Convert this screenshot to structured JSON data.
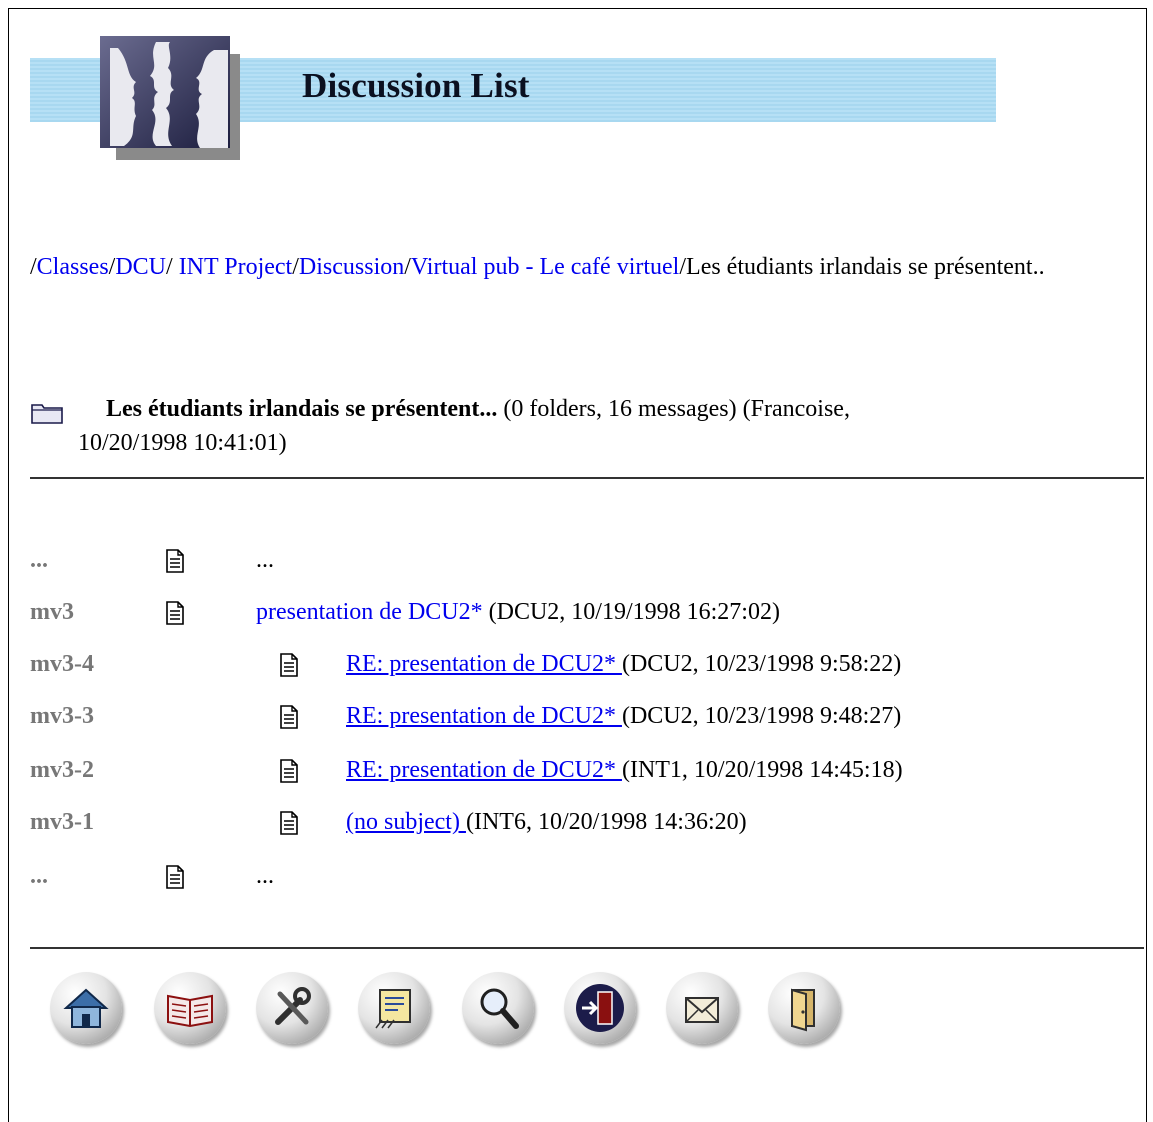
{
  "banner": {
    "title": "Discussion List"
  },
  "breadcrumb": {
    "sep": "/",
    "links": [
      "Classes",
      "DCU",
      " INT Project",
      "Discussion",
      "Virtual pub - Le café virtuel"
    ],
    "current": "Les étudiants irlandais se présentent.."
  },
  "folder": {
    "title": "Les étudiants irlandais se présentent...",
    "counts": "(0 folders, 16 messages)",
    "meta_line1": "(Francoise,",
    "meta_line2": "10/20/1998 10:41:01)"
  },
  "messages": [
    {
      "id": "...",
      "subject": "...",
      "meta": ""
    },
    {
      "id": "mv3",
      "subject": "presentation de DCU2*",
      "meta": " (DCU2, 10/19/1998 16:27:02)"
    },
    {
      "id": "mv3-4",
      "subject": "RE: presentation de DCU2* ",
      "meta": "(DCU2, 10/23/1998 9:58:22)"
    },
    {
      "id": "mv3-3",
      "subject": "RE: presentation de DCU2* ",
      "meta": "(DCU2, 10/23/1998 9:48:27)"
    },
    {
      "id": "mv3-2",
      "subject": "RE: presentation de DCU2* ",
      "meta": "(INT1, 10/20/1998 14:45:18)"
    },
    {
      "id": "mv3-1",
      "subject": "(no subject) ",
      "meta": "(INT6, 10/20/1998 14:36:20)"
    },
    {
      "id": "...",
      "subject": "...",
      "meta": ""
    }
  ],
  "toolbar": {
    "buttons": [
      "home-icon",
      "book-icon",
      "tools-icon",
      "post-message-icon",
      "search-icon",
      "exit-icon",
      "mail-icon",
      "door-icon"
    ]
  },
  "colors": {
    "link": "#0000ee",
    "banner": "#a8d8f0",
    "id_gray": "#777777"
  }
}
